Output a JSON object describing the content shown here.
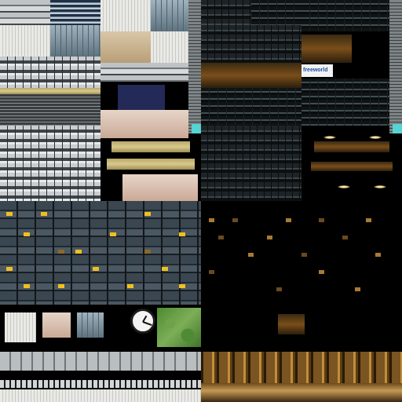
{
  "logo": {
    "text": "freeworld"
  },
  "tiles": {
    "clock": "clock-icon",
    "grass": "grass-texture"
  },
  "colors": {
    "lit_window": "#f0c020",
    "night_window": "#6b4a1f",
    "accent_teal": "#56d3d3",
    "gold": "#c08d3c"
  }
}
